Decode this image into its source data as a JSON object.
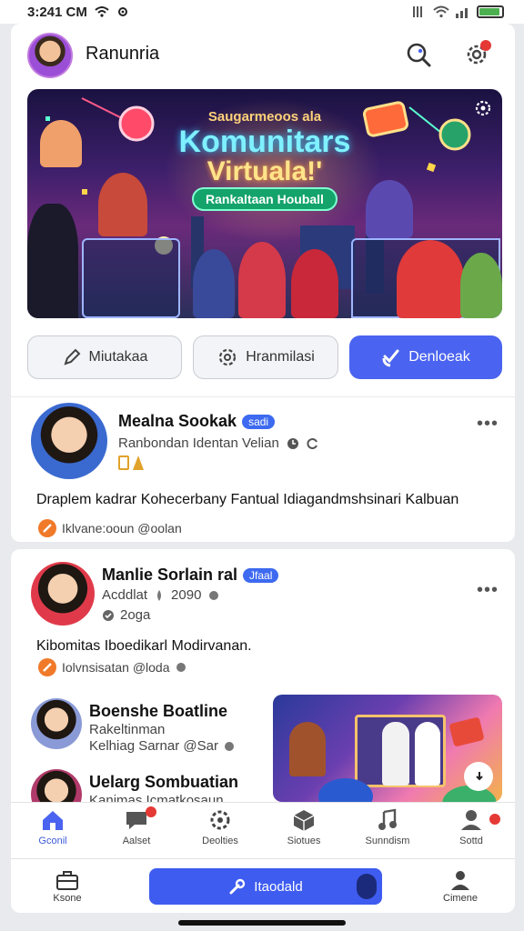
{
  "status_bar": {
    "time": "3:241 CM"
  },
  "header": {
    "app_title": "Ranunria"
  },
  "banner": {
    "kicker": "Saugarmeoos ala",
    "title_line1": "Komunitars",
    "title_line2": "Virtuala!'",
    "pill_label": "Rankaltaan Houball"
  },
  "actions": [
    {
      "label": "Miutakaa"
    },
    {
      "label": "Hranmilasi"
    },
    {
      "label": "Denloeak"
    }
  ],
  "posts": [
    {
      "name": "Mealna Sookak",
      "chip": "sadi",
      "subtitle": "Ranbondan Identan Velian",
      "body": "Draplem kadrar Kohecerbany Fantual Idiagandmshsinari Kalbuan",
      "meta": "Iklvane:ooun @oolan"
    },
    {
      "name": "Manlie Sorlain ral",
      "chip": "Jfaal",
      "subtitle": "Acddlat",
      "year": "2090",
      "sub2": "2oga",
      "body": "Kibomitas Iboedikarl Modirvanan.",
      "meta": "Iolvnsisatan @loda"
    }
  ],
  "list_items": [
    {
      "name": "Boenshe Boatline",
      "line1": "Rakeltinman",
      "line2": "Kelhiag Sarnar @Sar"
    },
    {
      "name": "Uelarg Sombuatian",
      "line1": "Kanimas Icmatkosaun"
    }
  ],
  "tabbar": [
    {
      "label": "Gconil"
    },
    {
      "label": "Aalset"
    },
    {
      "label": "Deolties"
    },
    {
      "label": "Siotues"
    },
    {
      "label": "Sunndism"
    },
    {
      "label": "Sottd"
    }
  ],
  "bottom_bar": {
    "left_label": "Ksone",
    "cta_label": "Itaodald",
    "right_label": "Cimene"
  },
  "colors": {
    "accent": "#4a63f0",
    "chip": "#3d6af0",
    "badge": "#e53935",
    "meta_orange": "#f07a2a"
  }
}
